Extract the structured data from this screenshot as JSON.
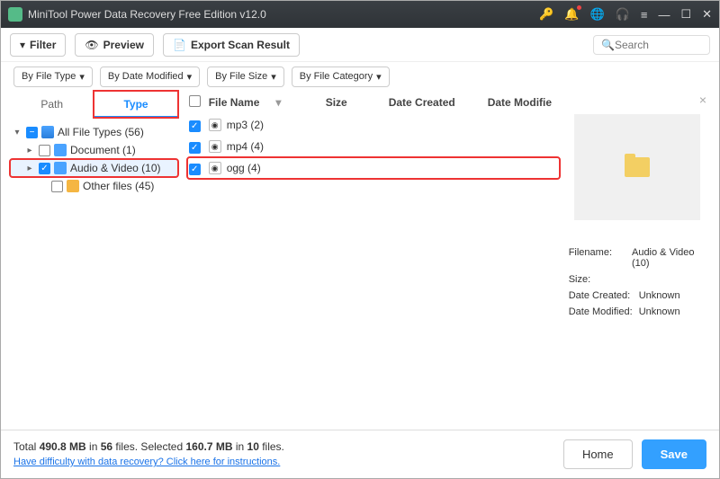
{
  "titlebar": {
    "title": "MiniTool Power Data Recovery Free Edition v12.0"
  },
  "toolbar": {
    "filter": "Filter",
    "preview": "Preview",
    "export": "Export Scan Result",
    "search_ph": "Search"
  },
  "filters": {
    "type": "By File Type",
    "date": "By Date Modified",
    "size": "By File Size",
    "cat": "By File Category"
  },
  "tabs": {
    "path": "Path",
    "type": "Type"
  },
  "tree": {
    "all": "All File Types (56)",
    "doc": "Document (1)",
    "av": "Audio & Video (10)",
    "other": "Other files (45)"
  },
  "cols": {
    "name": "File Name",
    "size": "Size",
    "created": "Date Created",
    "modified": "Date Modifie"
  },
  "rows": {
    "r1": "mp3 (2)",
    "r2": "mp4 (4)",
    "r3": "ogg (4)"
  },
  "detail": {
    "fn_k": "Filename:",
    "fn_v": "Audio & Video (10)",
    "sz_k": "Size:",
    "sz_v": "",
    "dc_k": "Date Created:",
    "dc_v": "Unknown",
    "dm_k": "Date Modified:",
    "dm_v": "Unknown"
  },
  "bottom": {
    "l1a": "Total ",
    "l1b": "490.8 MB",
    "l1c": " in ",
    "l1d": "56",
    "l1e": " files.   Selected ",
    "l1f": "160.7 MB",
    "l1g": " in ",
    "l1h": "10",
    "l1i": " files.",
    "help": "Have difficulty with data recovery? Click here for instructions.",
    "home": "Home",
    "save": "Save"
  }
}
